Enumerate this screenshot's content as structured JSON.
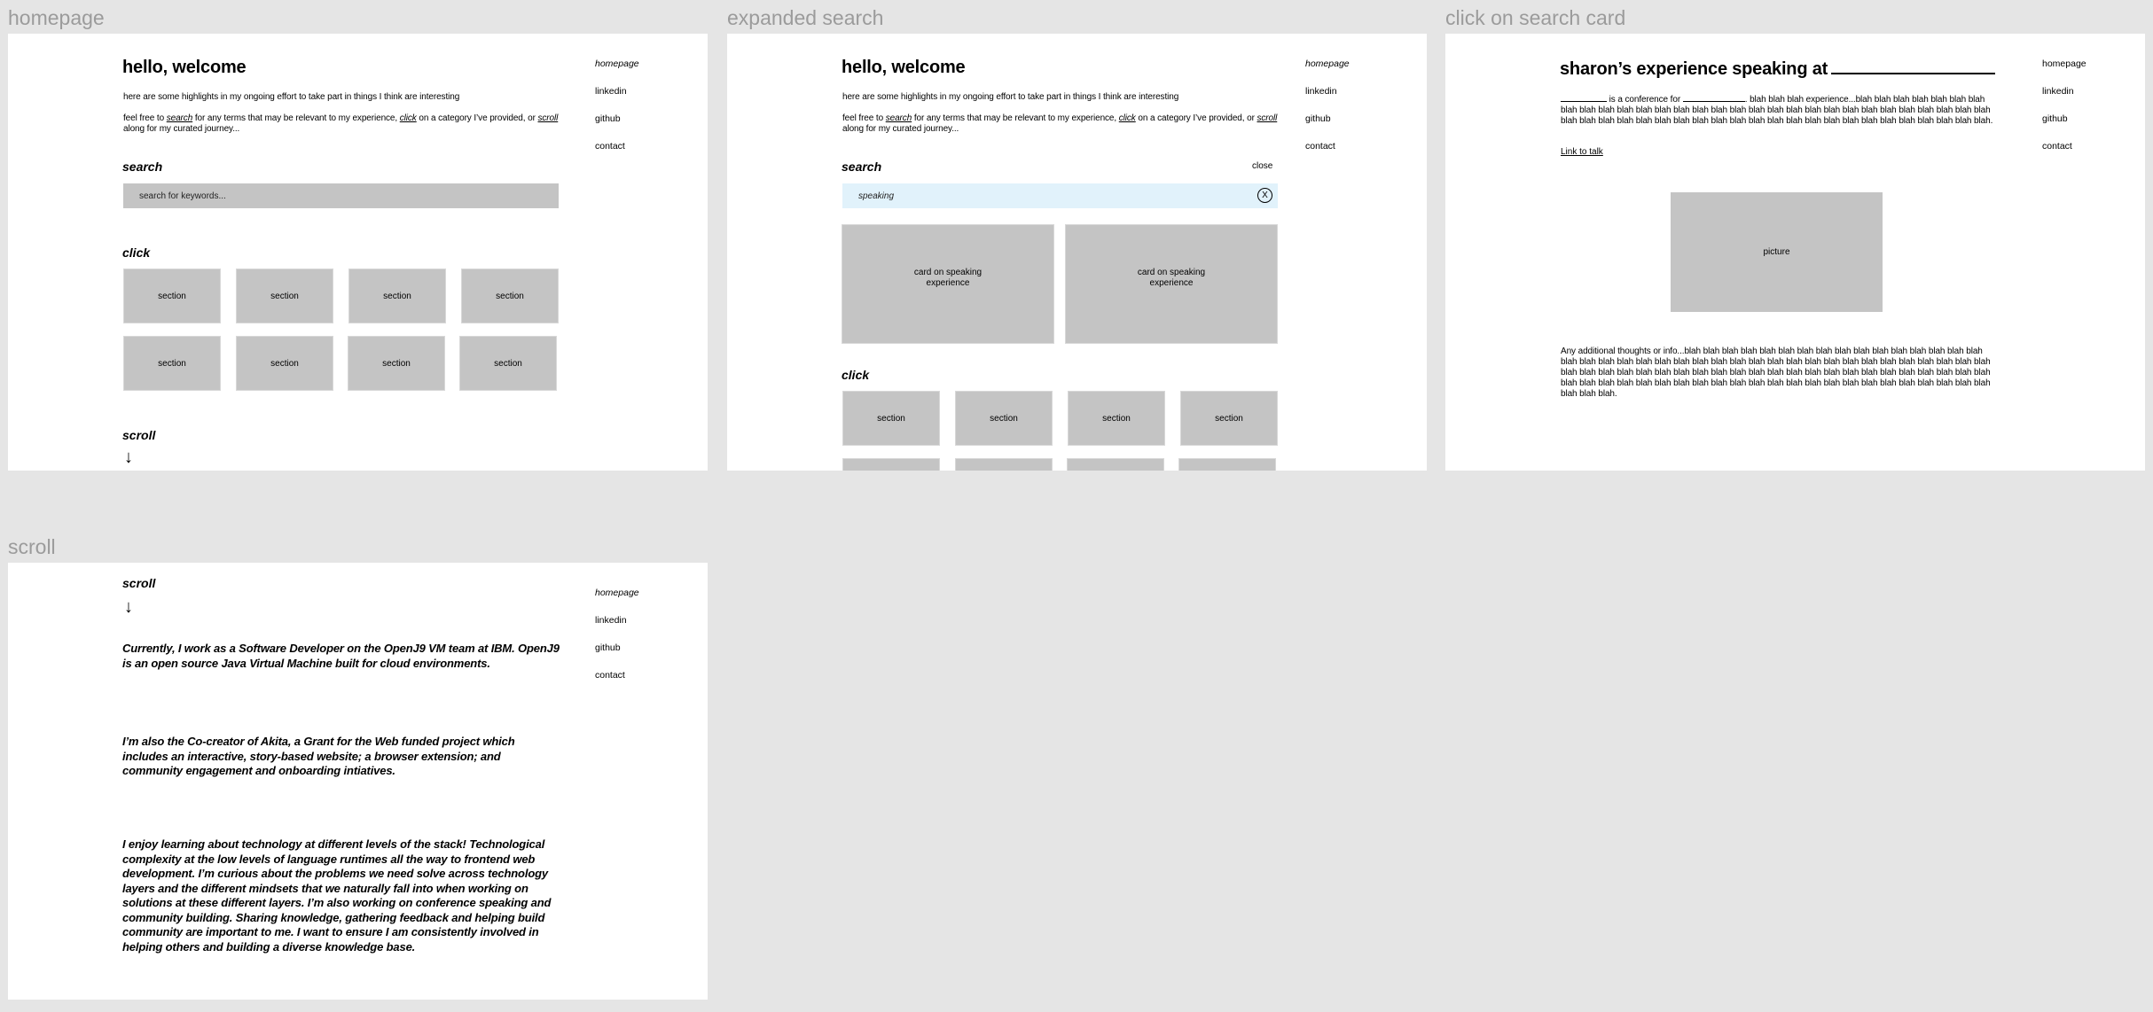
{
  "frames": {
    "homepage": {
      "label": "homepage",
      "title": "hello, welcome",
      "intro": "here are some highlights in my ongoing effort to take part in things I think are interesting",
      "instructions": {
        "prefix": "feel free to ",
        "search_word": "search",
        "middle1": " for any terms that may be relevant to my experience, ",
        "click_word": "click",
        "middle2": " on a category I’ve provided, or ",
        "scroll_word": "scroll",
        "suffix": " along for my curated journey..."
      },
      "search_heading": "search",
      "search_placeholder": "search for keywords...",
      "search_value": "",
      "click_heading": "click",
      "sections": [
        "section",
        "section",
        "section",
        "section",
        "section",
        "section",
        "section",
        "section"
      ],
      "scroll_heading": "scroll",
      "scroll_arrow": "↓"
    },
    "expanded_search": {
      "label": "expanded search",
      "title": "hello, welcome",
      "intro": "here are some highlights in my ongoing effort to take part in things I think are interesting",
      "instructions": {
        "prefix": "feel free to ",
        "search_word": "search",
        "middle1": " for any terms that may be relevant to my experience, ",
        "click_word": "click",
        "middle2": " on a category I’ve provided, or ",
        "scroll_word": "scroll",
        "suffix": " along for my curated journey..."
      },
      "search_heading": "search",
      "close_label": "close",
      "search_value": "speaking",
      "clear_label": "X",
      "result_cards": [
        "card on speaking experience",
        "card on speaking experience"
      ],
      "click_heading": "click",
      "sections": [
        "section",
        "section",
        "section",
        "section",
        "",
        "",
        "",
        ""
      ]
    },
    "search_card": {
      "label": "click on search card",
      "title": "sharon’s experience speaking at",
      "description": {
        "mid1": " is a conference for ",
        "rest": ". blah blah blah experience...blah blah blah blah blah blah blah blah blah blah blah blah blah blah blah blah blah blah blah blah blah blah blah blah blah blah blah blah blah blah blah blah blah blah blah blah blah blah blah blah blah blah blah blah blah blah blah blah blah blah blah blah blah."
      },
      "link_label": "Link to talk",
      "picture_label": "picture",
      "additional": "Any additional thoughts or info...blah blah blah blah blah blah blah blah blah blah blah blah blah blah blah blah blah blah blah blah blah blah blah blah blah blah blah blah blah blah blah blah blah blah blah blah blah blah blah blah blah blah blah blah blah blah blah blah blah blah blah blah blah blah blah blah blah blah blah blah blah blah blah blah blah blah blah blah blah blah blah blah blah blah blah blah blah blah blah blah blah blah blah blah blah blah blah blah."
    },
    "scroll": {
      "label": "scroll",
      "scroll_heading": "scroll",
      "scroll_arrow": "↓",
      "paragraphs": [
        "Currently, I work as a Software Developer on the OpenJ9 VM team at IBM. OpenJ9 is an open source Java Virtual Machine built for cloud environments.",
        "I’m also the Co-creator of Akita, a Grant for the Web funded project which includes an interactive, story-based website; a browser extension; and community engagement and onboarding intiatives.",
        "I enjoy learning about technology at different levels of the stack! Technological complexity at the low levels of language runtimes all the way to frontend web development. I’m curious about the problems we need solve across technology layers and the different mindsets that we naturally fall into when working on solutions at these different layers. I’m also working on conference speaking and community building. Sharing knowledge, gathering feedback and helping build community are important to me. I want to ensure I am consistently involved in helping others and building a diverse knowledge base."
      ]
    }
  },
  "nav": {
    "items": [
      "homepage",
      "linkedin",
      "github",
      "contact"
    ]
  },
  "colors": {
    "canvas": "#e5e5e5",
    "frame": "#ffffff",
    "placeholder_block": "#c4c4c4",
    "search_active": "#e1f2fb",
    "frame_label": "#9b9b9b"
  }
}
